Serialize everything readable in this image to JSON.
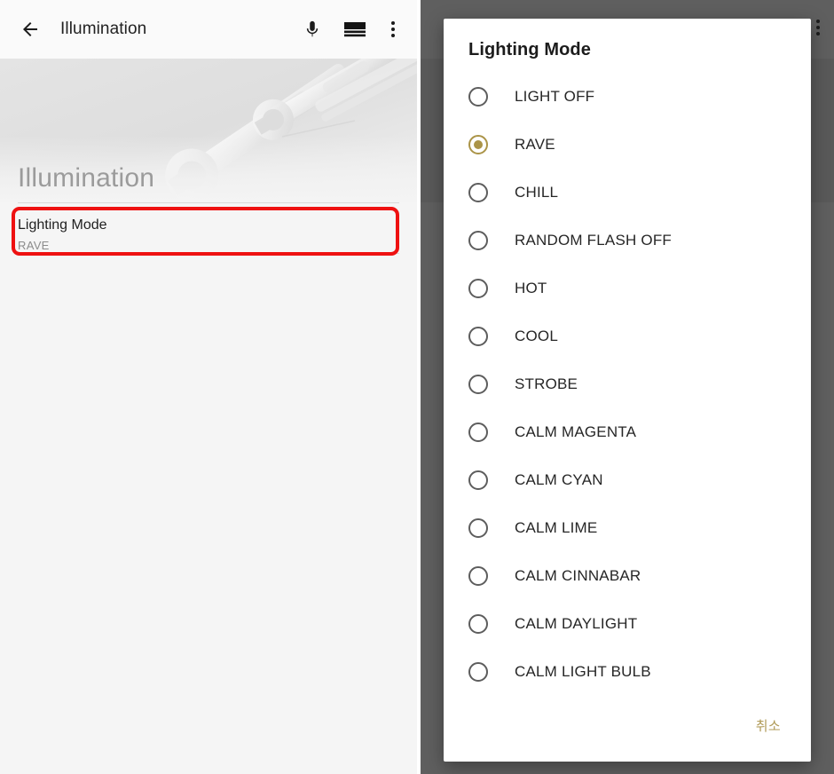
{
  "left_panel": {
    "toolbar": {
      "back_icon": "arrow-back-icon",
      "title": "Illumination",
      "actions": [
        {
          "icon": "microphone-icon",
          "name": "voice-search-button"
        },
        {
          "icon": "view-layout-icon",
          "name": "layout-toggle-button"
        },
        {
          "icon": "overflow-menu-icon",
          "name": "overflow-menu-button"
        }
      ]
    },
    "hero": {
      "title": "Illumination",
      "artwork": "wrench-tools-background"
    },
    "preferences": [
      {
        "title": "Lighting Mode",
        "summary": "RAVE"
      }
    ],
    "annotation": {
      "type": "highlight-rectangle",
      "color": "#ee1111",
      "target": "Lighting Mode"
    }
  },
  "dialog": {
    "title": "Lighting Mode",
    "selected_value": "RAVE",
    "options": [
      {
        "label": "LIGHT OFF",
        "selected": false
      },
      {
        "label": "RAVE",
        "selected": true
      },
      {
        "label": "CHILL",
        "selected": false
      },
      {
        "label": "RANDOM FLASH OFF",
        "selected": false
      },
      {
        "label": "HOT",
        "selected": false
      },
      {
        "label": "COOL",
        "selected": false
      },
      {
        "label": "STROBE",
        "selected": false
      },
      {
        "label": "CALM MAGENTA",
        "selected": false
      },
      {
        "label": "CALM CYAN",
        "selected": false
      },
      {
        "label": "CALM LIME",
        "selected": false
      },
      {
        "label": "CALM CINNABAR",
        "selected": false
      },
      {
        "label": "CALM DAYLIGHT",
        "selected": false
      },
      {
        "label": "CALM LIGHT BULB",
        "selected": false
      }
    ],
    "cancel_label": "취소"
  },
  "colors": {
    "accent": "#ab9448",
    "cancel_text": "#b09b58",
    "annotation_red": "#ee1111",
    "scrim": "#5f5f5f",
    "panel_background": "#f5f5f5",
    "toolbar_background": "#fafafa"
  }
}
